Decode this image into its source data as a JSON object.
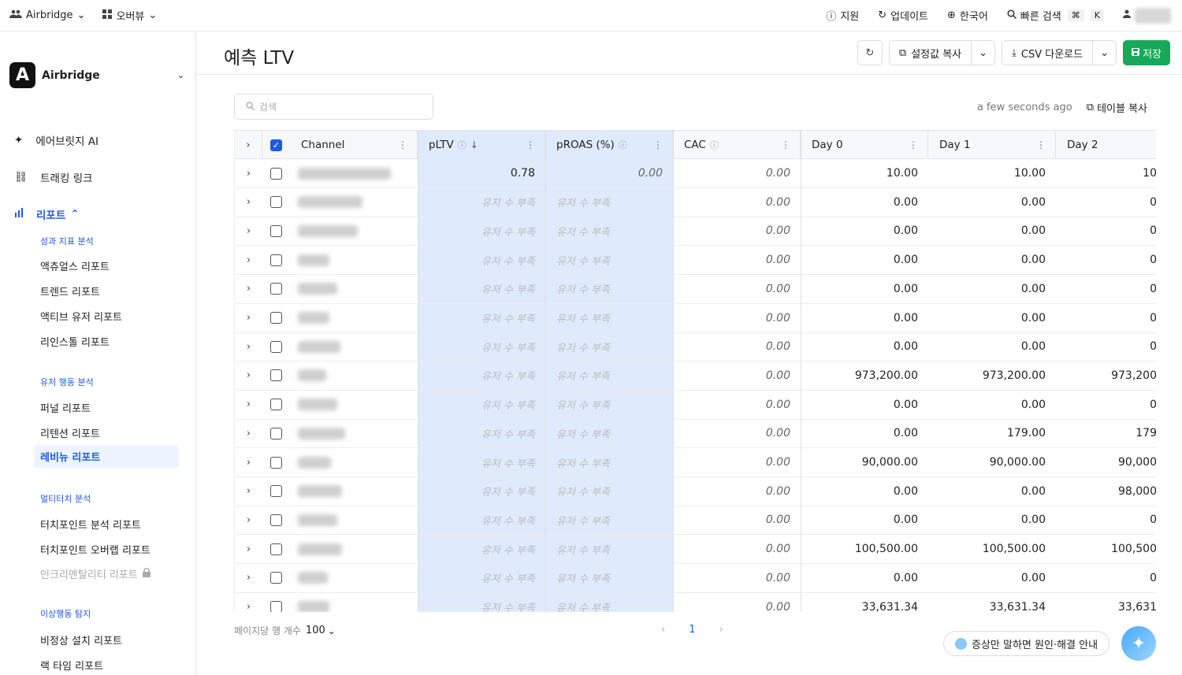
{
  "topbar": {
    "org": "Airbridge",
    "view": "오버뷰",
    "support": "지원",
    "updates": "업데이트",
    "language": "한국어",
    "quick_search": "빠른 검색",
    "kbd_cmd": "⌘",
    "kbd_k": "K"
  },
  "sidebar": {
    "workspace": "Airbridge",
    "workspace_logo": "A",
    "nav_ai": "에어브릿지 AI",
    "nav_tracking": "트래킹 링크",
    "nav_reports": "리포트",
    "sec_perf": "성과 지표 분석",
    "perf_items": [
      "액츄얼스 리포트",
      "트렌드 리포트",
      "액티브 유저 리포트",
      "리인스톨 리포트"
    ],
    "sec_behavior": "유저 행동 분석",
    "behavior_items": [
      "퍼널 리포트",
      "리텐션 리포트",
      "레비뉴 리포트"
    ],
    "sec_multi": "멀티터치 분석",
    "multi_items": [
      "터치포인트 분석 리포트",
      "터치포인트 오버랩 리포트",
      "인크리멘탈리티 리포트"
    ],
    "sec_fraud": "이상행동 탐지",
    "fraud_items": [
      "비정상 설치 리포트",
      "랙 타임 리포트"
    ]
  },
  "header": {
    "title": "예측 LTV",
    "copy_settings": "설정값 복사",
    "csv_download": "CSV 다운로드",
    "save": "저장"
  },
  "toolbar": {
    "search_placeholder": "검색",
    "updated": "a few seconds ago",
    "copy_table": "테이블 복사"
  },
  "table": {
    "columns": [
      "Channel",
      "pLTV",
      "pROAS (%)",
      "CAC",
      "Day 0",
      "Day 1",
      "Day 2"
    ],
    "rows": [
      {
        "pltv": "0.78",
        "proas": "0.00",
        "cac": "0.00",
        "d0": "10.00",
        "d1": "10.00",
        "d2": "10"
      },
      {
        "pltv": "유저 수 부족",
        "proas": "유저 수 부족",
        "cac": "0.00",
        "d0": "0.00",
        "d1": "0.00",
        "d2": "0"
      },
      {
        "pltv": "유저 수 부족",
        "proas": "유저 수 부족",
        "cac": "0.00",
        "d0": "0.00",
        "d1": "0.00",
        "d2": "0"
      },
      {
        "pltv": "유저 수 부족",
        "proas": "유저 수 부족",
        "cac": "0.00",
        "d0": "0.00",
        "d1": "0.00",
        "d2": "0"
      },
      {
        "pltv": "유저 수 부족",
        "proas": "유저 수 부족",
        "cac": "0.00",
        "d0": "0.00",
        "d1": "0.00",
        "d2": "0"
      },
      {
        "pltv": "유저 수 부족",
        "proas": "유저 수 부족",
        "cac": "0.00",
        "d0": "0.00",
        "d1": "0.00",
        "d2": "0"
      },
      {
        "pltv": "유저 수 부족",
        "proas": "유저 수 부족",
        "cac": "0.00",
        "d0": "0.00",
        "d1": "0.00",
        "d2": "0"
      },
      {
        "pltv": "유저 수 부족",
        "proas": "유저 수 부족",
        "cac": "0.00",
        "d0": "973,200.00",
        "d1": "973,200.00",
        "d2": "973,200"
      },
      {
        "pltv": "유저 수 부족",
        "proas": "유저 수 부족",
        "cac": "0.00",
        "d0": "0.00",
        "d1": "0.00",
        "d2": "0"
      },
      {
        "pltv": "유저 수 부족",
        "proas": "유저 수 부족",
        "cac": "0.00",
        "d0": "0.00",
        "d1": "179.00",
        "d2": "179"
      },
      {
        "pltv": "유저 수 부족",
        "proas": "유저 수 부족",
        "cac": "0.00",
        "d0": "90,000.00",
        "d1": "90,000.00",
        "d2": "90,000"
      },
      {
        "pltv": "유저 수 부족",
        "proas": "유저 수 부족",
        "cac": "0.00",
        "d0": "0.00",
        "d1": "0.00",
        "d2": "98,000"
      },
      {
        "pltv": "유저 수 부족",
        "proas": "유저 수 부족",
        "cac": "0.00",
        "d0": "0.00",
        "d1": "0.00",
        "d2": "0"
      },
      {
        "pltv": "유저 수 부족",
        "proas": "유저 수 부족",
        "cac": "0.00",
        "d0": "100,500.00",
        "d1": "100,500.00",
        "d2": "100,500"
      },
      {
        "pltv": "유저 수 부족",
        "proas": "유저 수 부족",
        "cac": "0.00",
        "d0": "0.00",
        "d1": "0.00",
        "d2": "0"
      },
      {
        "pltv": "유저 수 부족",
        "proas": "유저 수 부족",
        "cac": "0.00",
        "d0": "33,631.34",
        "d1": "33,631.34",
        "d2": "33,631"
      }
    ]
  },
  "pager": {
    "rows_label": "페이지당 행 개수",
    "rows_value": "100",
    "current_page": "1"
  },
  "help": {
    "label": "증상만 말하면 원인·해결 안내"
  },
  "colors": {
    "accent": "#1d5be6",
    "save": "#17a85a",
    "highlight": "#dfeafc"
  }
}
